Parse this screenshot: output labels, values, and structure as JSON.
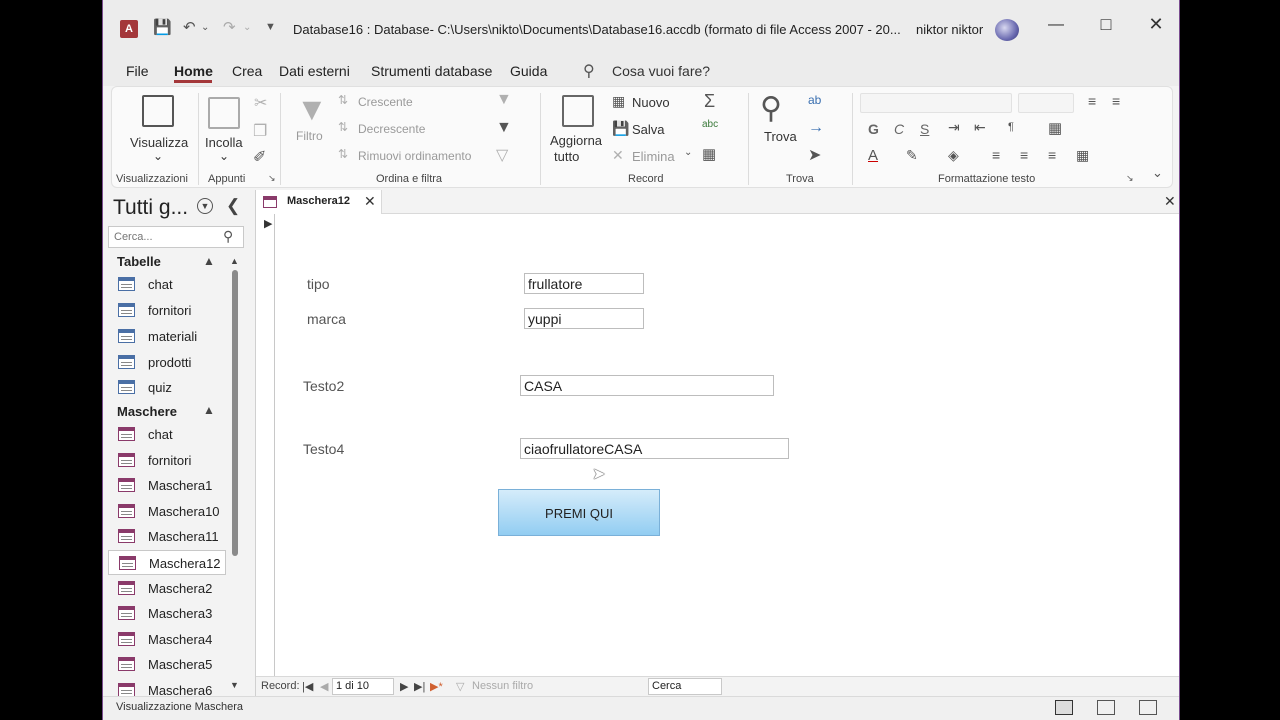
{
  "window": {
    "title": "Database16 : Database- C:\\Users\\nikto\\Documents\\Database16.accdb (formato di file Access 2007 - 20...",
    "user": "niktor niktor",
    "qat_icons": [
      "access-logo",
      "save-icon",
      "undo-icon",
      "redo-icon",
      "customize-icon"
    ]
  },
  "menu": {
    "tabs": [
      "File",
      "Home",
      "Crea",
      "Dati esterni",
      "Strumenti database",
      "Guida"
    ],
    "active_tab": "Home",
    "tell_me": "Cosa vuoi fare?"
  },
  "ribbon": {
    "view_label": "Visualizza",
    "paste_label": "Incolla",
    "filter_label": "Filtro",
    "ascending": "Crescente",
    "descending": "Decrescente",
    "remove_sort": "Rimuovi ordinamento",
    "refresh_line1": "Aggiorna",
    "refresh_line2": "tutto",
    "new": "Nuovo",
    "save": "Salva",
    "delete": "Elimina",
    "find": "Trova",
    "bold": "G",
    "italic": "C",
    "underline": "S",
    "groups": [
      "Visualizzazioni",
      "Appunti",
      "Ordina e filtra",
      "Record",
      "Trova",
      "Formattazione testo"
    ]
  },
  "nav": {
    "title": "Tutti g...",
    "search_placeholder": "Cerca...",
    "sections": {
      "tables": {
        "label": "Tabelle",
        "items": [
          "chat",
          "fornitori",
          "materiali",
          "prodotti",
          "quiz"
        ]
      },
      "forms": {
        "label": "Maschere",
        "items": [
          "chat",
          "fornitori",
          "Maschera1",
          "Maschera10",
          "Maschera11",
          "Maschera12",
          "Maschera2",
          "Maschera3",
          "Maschera4",
          "Maschera5",
          "Maschera6"
        ],
        "selected": "Maschera12"
      }
    }
  },
  "document": {
    "tab_label": "Maschera12",
    "fields": {
      "tipo_label": "tipo",
      "tipo_value": "frullatore",
      "marca_label": "marca",
      "marca_value": "yuppi",
      "testo2_label": "Testo2",
      "testo2_value": "CASA",
      "testo4_label": "Testo4",
      "testo4_value": "ciaofrullatoreCASA"
    },
    "button_label": "PREMI QUI"
  },
  "record_nav": {
    "label": "Record:",
    "position": "1 di 10",
    "filter_status": "Nessun filtro",
    "search_placeholder": "Cerca"
  },
  "status": {
    "text": "Visualizzazione Maschera",
    "active_view": "form-view"
  }
}
